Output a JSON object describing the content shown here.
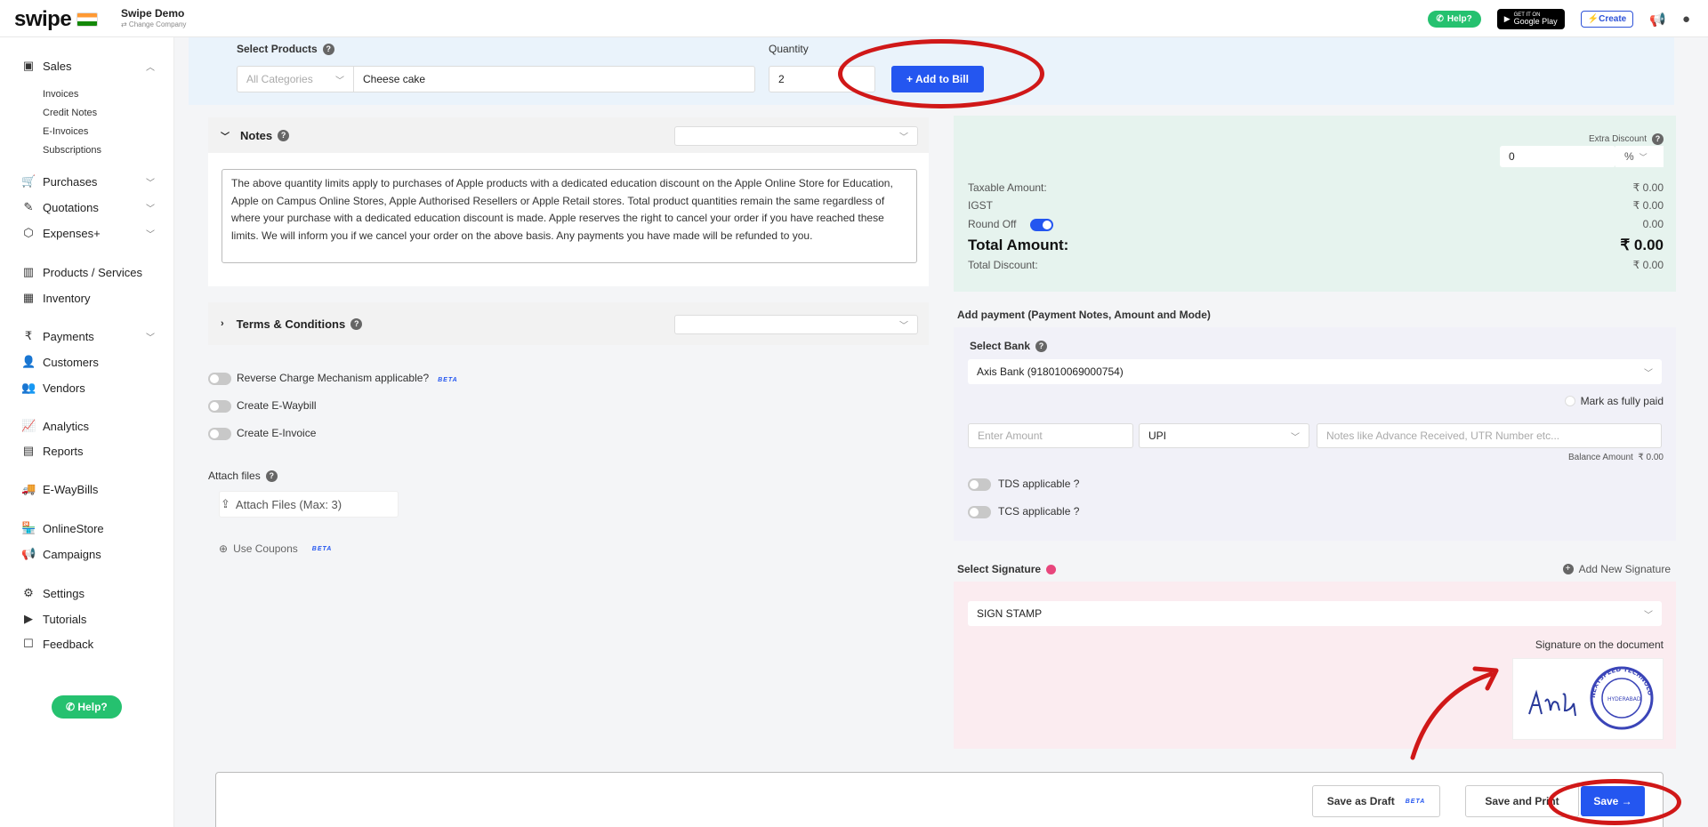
{
  "topbar": {
    "logo": "swipe",
    "company_name": "Swipe Demo",
    "change_company": "⇄ Change Company",
    "help_label": "Help?",
    "google_play": "Google Play",
    "google_play_small": "GET IT ON",
    "create_label": "⚡Create"
  },
  "sidebar": {
    "sales": "Sales",
    "sales_sub": [
      "Invoices",
      "Credit Notes",
      "E-Invoices",
      "Subscriptions"
    ],
    "purchases": "Purchases",
    "quotations": "Quotations",
    "expenses": "Expenses+",
    "products": "Products / Services",
    "inventory": "Inventory",
    "payments": "Payments",
    "customers": "Customers",
    "vendors": "Vendors",
    "analytics": "Analytics",
    "reports": "Reports",
    "ewaybills": "E-WayBills",
    "onlinestore": "OnlineStore",
    "campaigns": "Campaigns",
    "settings": "Settings",
    "tutorials": "Tutorials",
    "feedback": "Feedback",
    "help": "Help?"
  },
  "products": {
    "label": "Select Products",
    "quantity_label": "Quantity",
    "category_placeholder": "All Categories",
    "product_value": "Cheese cake",
    "quantity_value": "2",
    "add_to_bill": "+ Add to Bill"
  },
  "notes": {
    "title": "Notes",
    "text": "The above quantity limits apply to purchases of Apple products with a dedicated education discount on the Apple Online Store for Education, Apple on Campus Online Stores, Apple Authorised Resellers or Apple Retail stores. Total product quantities remain the same regardless of where your purchase with a dedicated education discount is made. Apple reserves the right to cancel your order if you have reached these limits. We will inform you if we cancel your order on the above basis. Any payments you have made will be refunded to you."
  },
  "terms": {
    "title": "Terms & Conditions"
  },
  "options": {
    "reverse_charge": "Reverse Charge Mechanism applicable?",
    "beta": "BETA",
    "eway": "Create E-Waybill",
    "einvoice": "Create E-Invoice",
    "attach_label": "Attach files",
    "attach_button": "Attach Files (Max: 3)",
    "coupons": "Use Coupons"
  },
  "summary": {
    "extra_discount_label": "Extra Discount",
    "extra_discount_value": "0",
    "discount_unit": "%",
    "taxable_label": "Taxable Amount:",
    "taxable_value": "₹ 0.00",
    "igst_label": "IGST",
    "igst_value": "₹ 0.00",
    "round_off_label": "Round Off",
    "round_off_value": "0.00",
    "total_label": "Total Amount:",
    "total_value": "₹ 0.00",
    "total_discount_label": "Total Discount:",
    "total_discount_value": "₹ 0.00"
  },
  "payment": {
    "heading": "Add payment (Payment Notes, Amount and Mode)",
    "bank_label": "Select Bank",
    "bank_value": "Axis Bank (918010069000754)",
    "mark_paid": "Mark as fully paid",
    "amount_placeholder": "Enter Amount",
    "mode_value": "UPI",
    "notes_placeholder": "Notes like Advance Received, UTR Number etc...",
    "balance_label": "Balance Amount",
    "balance_value": "₹ 0.00",
    "tds": "TDS applicable ?",
    "tcs": "TCS applicable ?"
  },
  "signature": {
    "label": "Select Signature",
    "add_new": "Add New Signature",
    "value": "SIGN STAMP",
    "on_document": "Signature on the document",
    "stamp_text": "NEXTSPEED TECHNOLOGIES PVT. LTD.",
    "stamp_city": "HYDERABAD",
    "scribble": "Adiy"
  },
  "footer": {
    "save_draft": "Save as Draft",
    "beta": "BETA",
    "save_print": "Save and Print",
    "save": "Save →"
  },
  "colors": {
    "accent": "#2456f0",
    "whatsapp": "#25c16f",
    "annotation_red": "#d01818"
  }
}
